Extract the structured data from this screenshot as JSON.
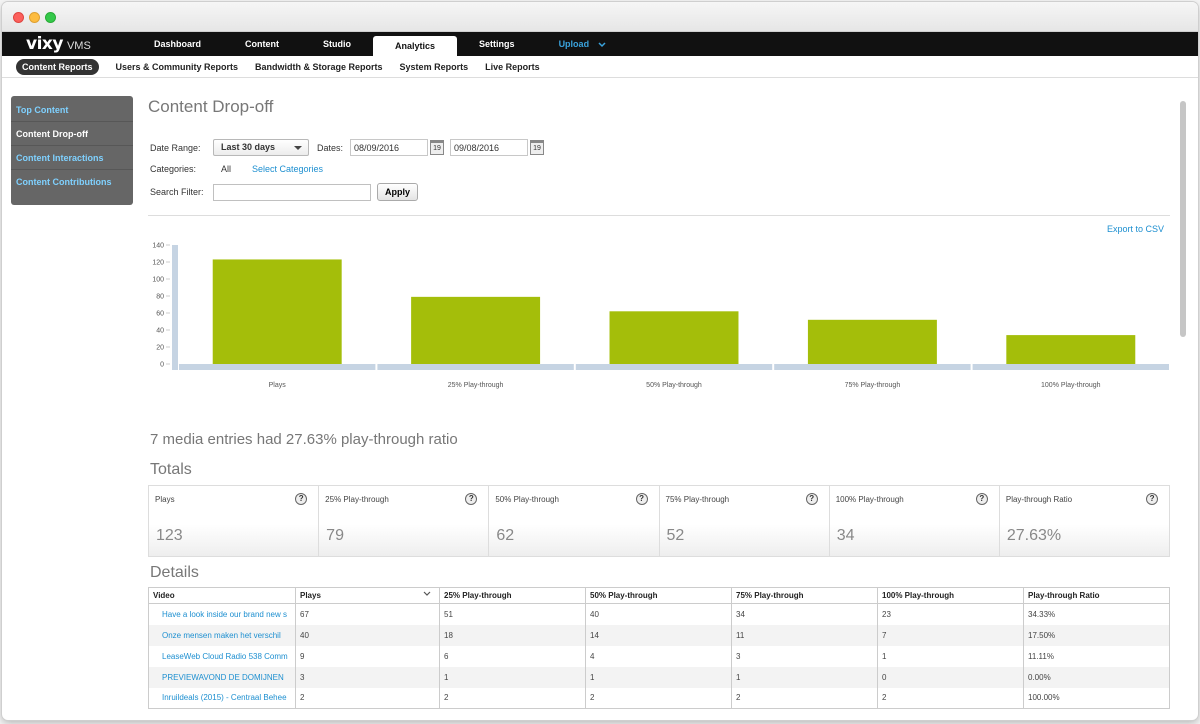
{
  "app": {
    "logo": "vixy",
    "logo_sub": "VMS"
  },
  "nav": {
    "items": [
      {
        "label": "Dashboard"
      },
      {
        "label": "Content"
      },
      {
        "label": "Studio"
      },
      {
        "label": "Analytics"
      },
      {
        "label": "Settings"
      },
      {
        "label": "Upload"
      }
    ]
  },
  "subnav": {
    "items": [
      {
        "label": "Content Reports"
      },
      {
        "label": "Users & Community Reports"
      },
      {
        "label": "Bandwidth & Storage Reports"
      },
      {
        "label": "System Reports"
      },
      {
        "label": "Live Reports"
      }
    ]
  },
  "sidebar": {
    "items": [
      {
        "label": "Top Content"
      },
      {
        "label": "Content Drop-off"
      },
      {
        "label": "Content Interactions"
      },
      {
        "label": "Content Contributions"
      }
    ]
  },
  "page": {
    "title": "Content Drop-off",
    "date_range_label": "Date Range:",
    "date_range_value": "Last 30 days",
    "dates_label": "Dates:",
    "date_from": "08/09/2016",
    "date_to": "09/08/2016",
    "calendar_day": "19",
    "categories_label": "Categories:",
    "categories_value": "All",
    "select_categories": "Select Categories",
    "search_label": "Search Filter:",
    "search_value": "",
    "apply_label": "Apply",
    "export_label": "Export to CSV",
    "summary": "7 media entries had 27.63% play-through ratio",
    "totals_heading": "Totals",
    "details_heading": "Details"
  },
  "chart_data": {
    "type": "bar",
    "categories": [
      "Plays",
      "25% Play-through",
      "50% Play-through",
      "75% Play-through",
      "100% Play-through"
    ],
    "values": [
      123,
      79,
      62,
      52,
      34
    ],
    "yticks": [
      0,
      20,
      40,
      60,
      80,
      100,
      120,
      140
    ],
    "ylim": [
      0,
      140
    ],
    "bar_color": "#a4be0a",
    "axis_color": "#c6d4e3"
  },
  "totals": [
    {
      "label": "Plays",
      "value": "123"
    },
    {
      "label": "25% Play-through",
      "value": "79"
    },
    {
      "label": "50% Play-through",
      "value": "62"
    },
    {
      "label": "75% Play-through",
      "value": "52"
    },
    {
      "label": "100% Play-through",
      "value": "34"
    },
    {
      "label": "Play-through Ratio",
      "value": "27.63%"
    }
  ],
  "help_glyph": "?",
  "details": {
    "columns": [
      "Video",
      "Plays",
      "25% Play-through",
      "50% Play-through",
      "75% Play-through",
      "100% Play-through",
      "Play-through Ratio"
    ],
    "rows": [
      [
        "Have a look inside our brand new s",
        "67",
        "51",
        "40",
        "34",
        "23",
        "34.33%"
      ],
      [
        "Onze mensen maken het verschil",
        "40",
        "18",
        "14",
        "11",
        "7",
        "17.50%"
      ],
      [
        "LeaseWeb Cloud Radio 538 Comm",
        "9",
        "6",
        "4",
        "3",
        "1",
        "11.11%"
      ],
      [
        "PREVIEWAVOND DE DOMIJNEN",
        "3",
        "1",
        "1",
        "1",
        "0",
        "0.00%"
      ],
      [
        "Inruildeals (2015) - Centraal Behee",
        "2",
        "2",
        "2",
        "2",
        "2",
        "100.00%"
      ]
    ]
  }
}
